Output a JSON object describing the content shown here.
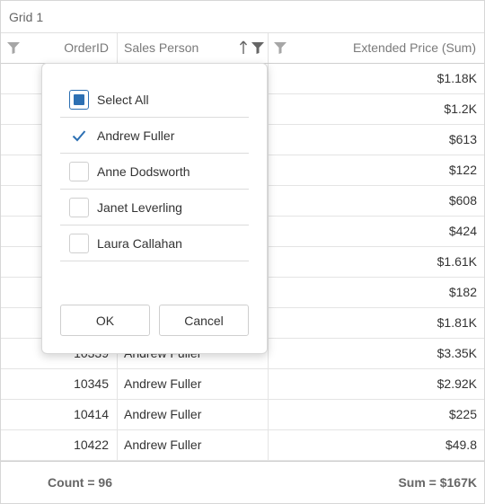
{
  "grid_title": "Grid 1",
  "columns": [
    {
      "label": "OrderID"
    },
    {
      "label": "Sales Person"
    },
    {
      "label": "Extended Price (Sum)"
    }
  ],
  "rows": [
    {
      "order_id": "",
      "sales_person": "",
      "price": "$1.18K"
    },
    {
      "order_id": "",
      "sales_person": "",
      "price": "$1.2K"
    },
    {
      "order_id": "",
      "sales_person": "",
      "price": "$613"
    },
    {
      "order_id": "",
      "sales_person": "",
      "price": "$122"
    },
    {
      "order_id": "",
      "sales_person": "",
      "price": "$608"
    },
    {
      "order_id": "",
      "sales_person": "",
      "price": "$424"
    },
    {
      "order_id": "",
      "sales_person": "",
      "price": "$1.61K"
    },
    {
      "order_id": "",
      "sales_person": "",
      "price": "$182"
    },
    {
      "order_id": "",
      "sales_person": "",
      "price": "$1.81K"
    },
    {
      "order_id": "10339",
      "sales_person": "Andrew Fuller",
      "price": "$3.35K"
    },
    {
      "order_id": "10345",
      "sales_person": "Andrew Fuller",
      "price": "$2.92K"
    },
    {
      "order_id": "10414",
      "sales_person": "Andrew Fuller",
      "price": "$225"
    },
    {
      "order_id": "10422",
      "sales_person": "Andrew Fuller",
      "price": "$49.8"
    }
  ],
  "footer": {
    "count": "Count = 96",
    "sum": "Sum = $167K"
  },
  "filter_popup": {
    "items": [
      {
        "label": "Select All",
        "state": "partial"
      },
      {
        "label": "Andrew Fuller",
        "state": "checked"
      },
      {
        "label": "Anne Dodsworth",
        "state": "unchecked"
      },
      {
        "label": "Janet Leverling",
        "state": "unchecked"
      },
      {
        "label": "Laura Callahan",
        "state": "unchecked"
      }
    ],
    "ok_label": "OK",
    "cancel_label": "Cancel"
  },
  "colors": {
    "accent": "#2d70b3",
    "border": "#d6d6d6",
    "header_text": "#7a7a7a",
    "filter_icon": "#a6a6a6",
    "filter_icon_active": "#666666"
  },
  "icons": {
    "filter": "filter-funnel-icon",
    "sort": "sort-ascending-arrow-icon",
    "check": "checkmark-icon"
  }
}
